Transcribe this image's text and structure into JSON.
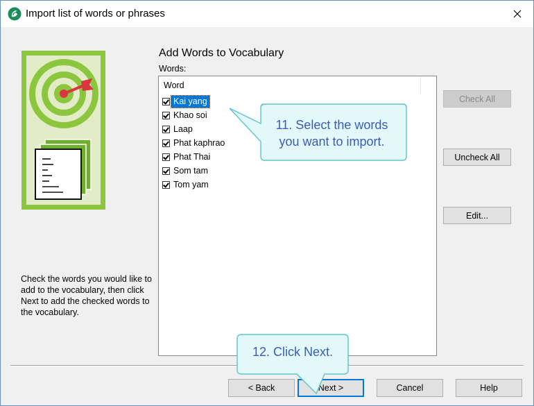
{
  "window": {
    "title": "Import list of words or phrases",
    "close_symbol": "✕"
  },
  "section_title": "Add Words to Vocabulary",
  "words_label": "Words:",
  "list": {
    "column_header": "Word",
    "items": [
      {
        "label": "Kai yang",
        "checked": true,
        "selected": true
      },
      {
        "label": "Khao soi",
        "checked": true,
        "selected": false
      },
      {
        "label": "Laap",
        "checked": true,
        "selected": false
      },
      {
        "label": "Phat kaphrao",
        "checked": true,
        "selected": false
      },
      {
        "label": "Phat Thai",
        "checked": true,
        "selected": false
      },
      {
        "label": "Som tam",
        "checked": true,
        "selected": false
      },
      {
        "label": "Tom yam",
        "checked": true,
        "selected": false
      }
    ]
  },
  "side_buttons": {
    "check_all": "Check All",
    "uncheck_all": "Uncheck All",
    "edit": "Edit..."
  },
  "help_text": "Check the words you would like to add to the vocabulary, then click Next to add the checked words to the vocabulary.",
  "bottom_buttons": {
    "back": "< Back",
    "next": "Next >",
    "cancel": "Cancel",
    "help": "Help"
  },
  "callouts": {
    "select_words_line1": "11. Select the words",
    "select_words_line2": "you want to import.",
    "click_next": "12. Click Next."
  },
  "colors": {
    "illustration_green": "#8cc63f",
    "selection_blue": "#0078d7",
    "callout_fill": "#e3f8f9",
    "callout_border": "#5fc4c8",
    "callout_text": "#3f5bb0",
    "target_red": "#d9363e"
  }
}
